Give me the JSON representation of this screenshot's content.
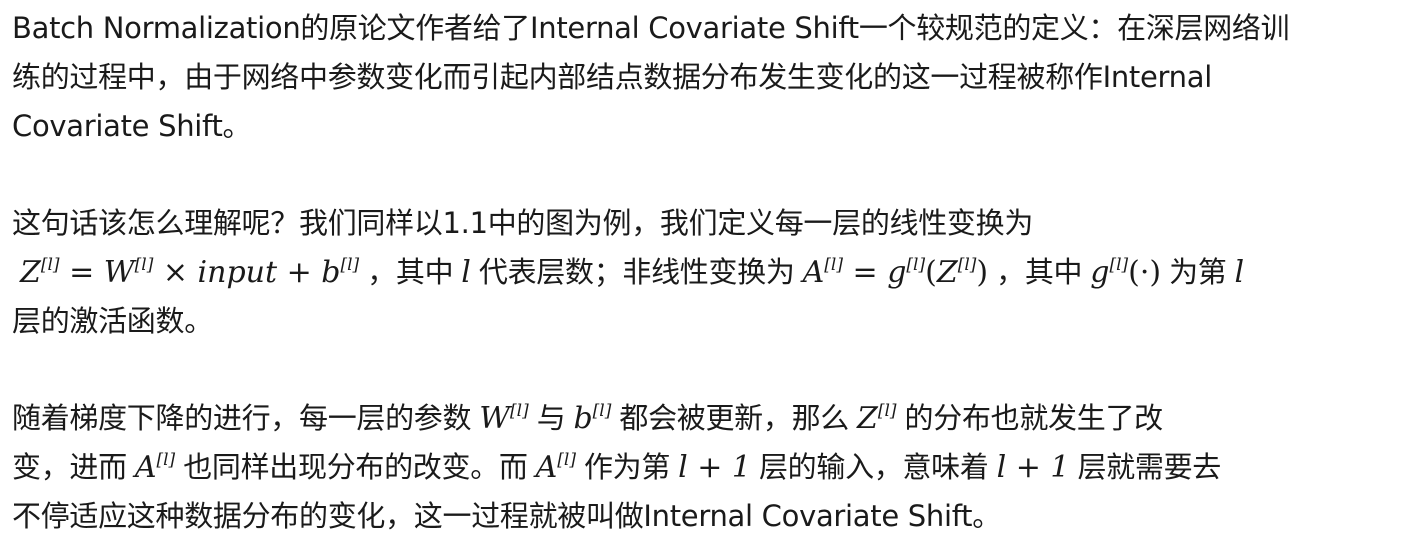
{
  "p1": {
    "line1": "Batch Normalization的原论文作者给了Internal Covariate Shift一个较规范的定义：在深层网络训",
    "line2": "练的过程中，由于网络中参数变化而引起内部结点数据分布发生变化的这一过程被称作Internal",
    "line3": "Covariate Shift。"
  },
  "p2": {
    "line1": "这句话该怎么理解呢？我们同样以1.1中的图为例，我们定义每一层的线性变换为",
    "t_comma1": "，其中",
    "t_layer": "代表层数；非线性变换为",
    "t_comma2": "，其中",
    "t_for": "为第",
    "line3": "层的激活函数。",
    "math": {
      "z": "Z",
      "sup": "[l]",
      "eq": " = ",
      "w": "W",
      "times": " × ",
      "input": "input",
      "plus": " + ",
      "b": "b",
      "l": "l",
      "a": "A",
      "g": "g",
      "lparen": "(",
      "rparen": ")",
      "dot": "(·)"
    }
  },
  "p3": {
    "t1": "随着梯度下降的进行，每一层的参数",
    "t2": "与",
    "t3": "都会被更新，那么",
    "t4": "的分布也就发生了改",
    "t5": "变，进而",
    "t6": "也同样出现分布的改变。而",
    "t7": "作为第",
    "t8": "层的输入，意味着",
    "t9": "层就需要去",
    "line3": "不停适应这种数据分布的变化，这一过程就被叫做Internal Covariate Shift。",
    "lplus1": "l + 1"
  }
}
